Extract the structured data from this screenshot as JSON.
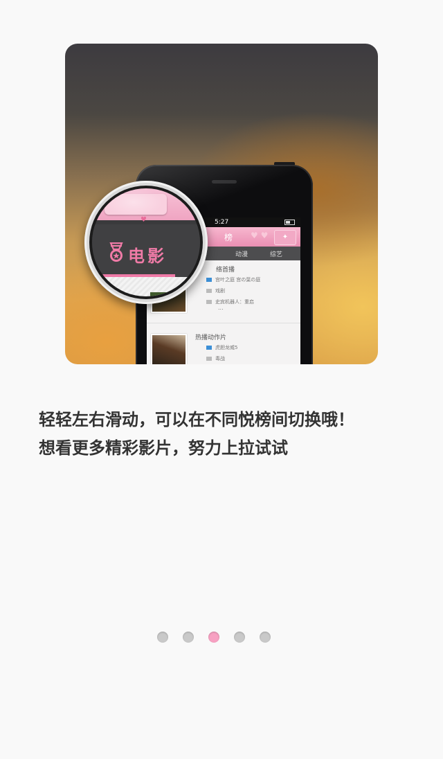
{
  "caption": {
    "line1": "轻轻左右滑动，可以在不同悦榜间切换哦！",
    "line2": "想看更多精彩影片，努力上拉试试"
  },
  "phone": {
    "status_time": "5:27",
    "title": "榜",
    "tabs": [
      "动漫",
      "综艺"
    ],
    "sections": [
      {
        "title": "络首播",
        "rows": [
          "宫叶之庭 宫の葉の庭",
          "戏剧",
          "史宾机器人：重启"
        ],
        "more": "..."
      },
      {
        "title": "热播动作片",
        "rows": [
          "虎胆龙威5",
          "毒战"
        ]
      }
    ]
  },
  "magnifier": {
    "label": "电影",
    "icon": "medal-icon"
  },
  "pager": {
    "count": 5,
    "active_index": 2
  },
  "colors": {
    "accent_pink": "#f07ba7",
    "dot_inactive": "#c9c9c9",
    "dot_active": "#f7a1c2"
  }
}
